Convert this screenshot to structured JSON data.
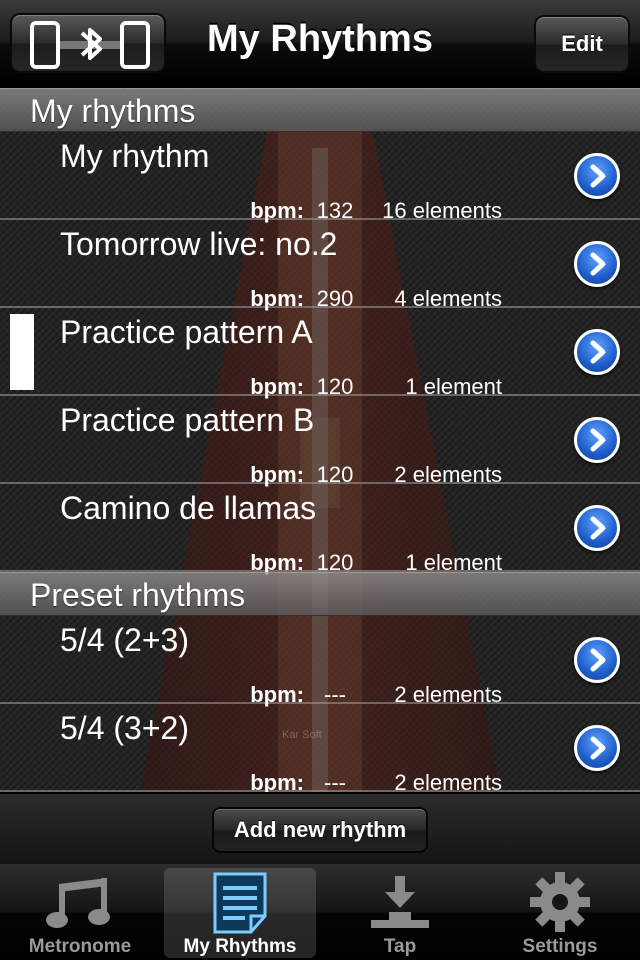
{
  "nav": {
    "title": "My Rhythms",
    "edit_label": "Edit",
    "connect_icon": "phones-bluetooth-icon"
  },
  "sections": [
    {
      "header": "My rhythms",
      "rows": [
        {
          "name": "My rhythm",
          "bpm_label": "bpm:",
          "bpm": "132",
          "elements": "16 elements",
          "selected": false
        },
        {
          "name": "Tomorrow live: no.2",
          "bpm_label": "bpm:",
          "bpm": "290",
          "elements": "4 elements",
          "selected": false
        },
        {
          "name": "Practice pattern A",
          "bpm_label": "bpm:",
          "bpm": "120",
          "elements": "1 element",
          "selected": true
        },
        {
          "name": "Practice pattern B",
          "bpm_label": "bpm:",
          "bpm": "120",
          "elements": "2 elements",
          "selected": false
        },
        {
          "name": "Camino de llamas",
          "bpm_label": "bpm:",
          "bpm": "120",
          "elements": "1 element",
          "selected": false
        }
      ]
    },
    {
      "header": "Preset rhythms",
      "rows": [
        {
          "name": "5/4 (2+3)",
          "bpm_label": "bpm:",
          "bpm": "---",
          "elements": "2 elements",
          "selected": false
        },
        {
          "name": "5/4 (3+2)",
          "bpm_label": "bpm:",
          "bpm": "---",
          "elements": "2 elements",
          "selected": false
        }
      ]
    }
  ],
  "add_button_label": "Add new rhythm",
  "tabs": [
    {
      "label": "Metronome",
      "icon": "music-note-icon",
      "active": false
    },
    {
      "label": "My Rhythms",
      "icon": "document-list-icon",
      "active": true
    },
    {
      "label": "Tap",
      "icon": "tap-icon",
      "active": false
    },
    {
      "label": "Settings",
      "icon": "gear-icon",
      "active": false
    }
  ],
  "colors": {
    "disclosure_blue": "#1e5dc9",
    "active_tab_icon": "#7ecbff",
    "inactive_tab": "#9a9a9a"
  }
}
